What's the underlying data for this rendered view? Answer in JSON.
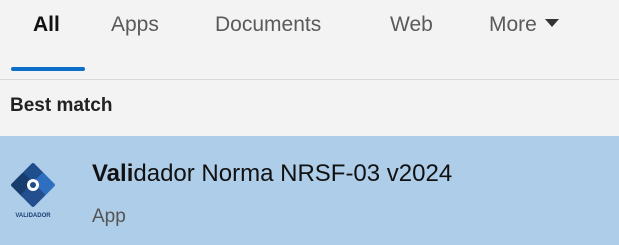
{
  "tabs": [
    {
      "label": "All",
      "active": true
    },
    {
      "label": "Apps",
      "active": false
    },
    {
      "label": "Documents",
      "active": false
    },
    {
      "label": "Web",
      "active": false
    },
    {
      "label": "More",
      "active": false
    }
  ],
  "section": {
    "label": "Best match"
  },
  "result": {
    "title_match": "Vali",
    "title_rest": "dador Norma NRSF-03 v2024",
    "type": "App",
    "icon": "validador-app-icon",
    "icon_text": "VALIDADOR"
  },
  "colors": {
    "accent": "#0a6ec8",
    "selection": "#aecde8",
    "background": "#f3f3f3"
  }
}
